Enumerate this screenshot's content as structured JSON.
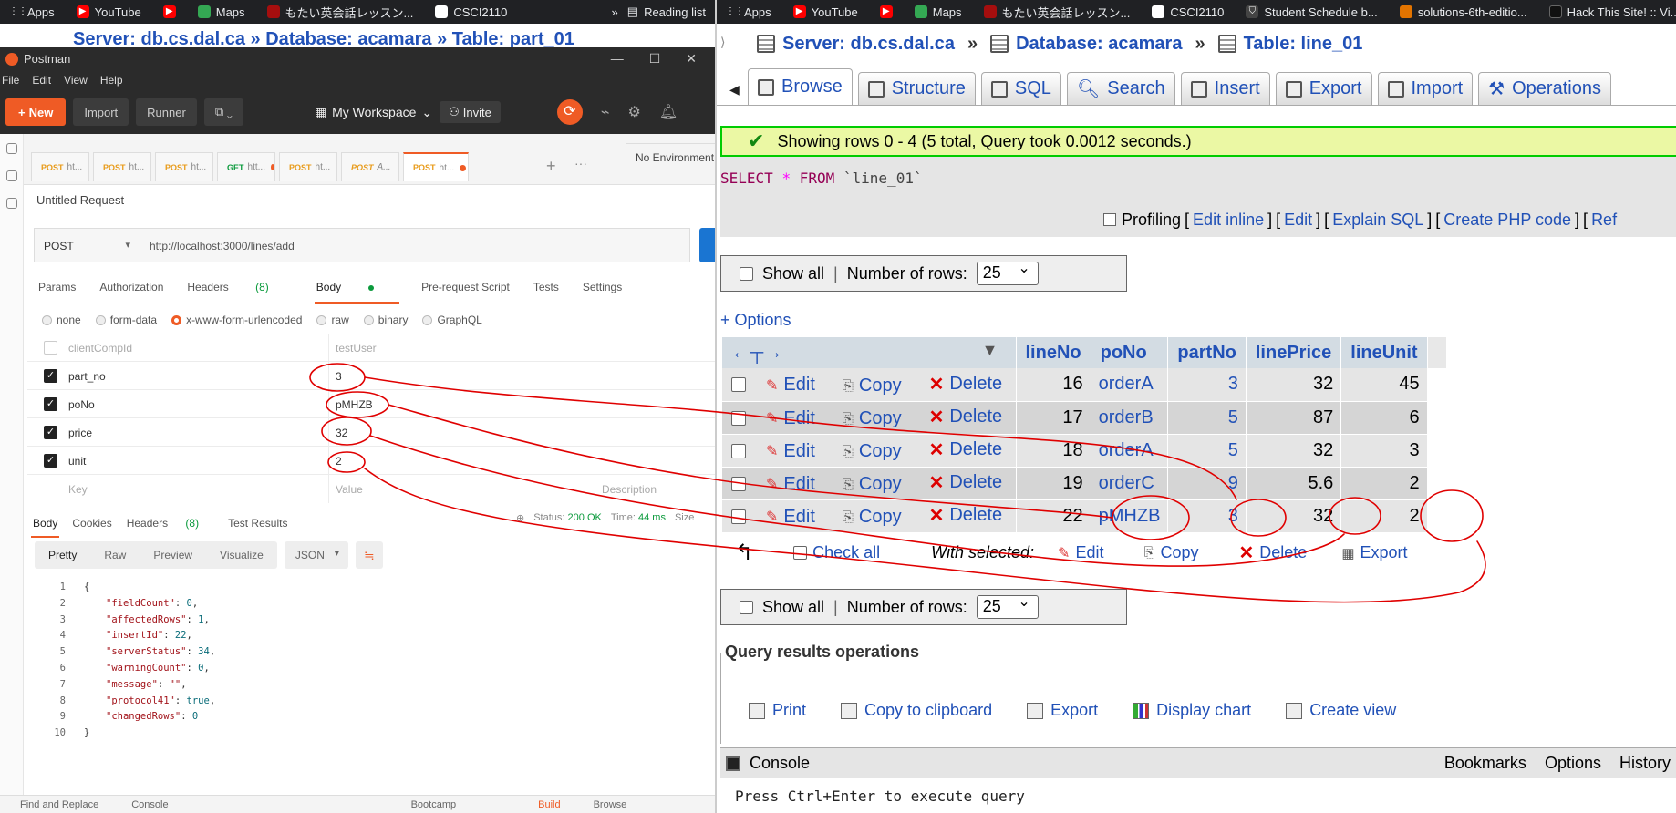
{
  "bookmarks_left": [
    "Apps",
    "YouTube",
    "",
    "Maps",
    "もたい英会話レッスン...",
    "CSCI2110"
  ],
  "bookmarks_left_extra": [
    "»",
    "Reading list"
  ],
  "bookmarks_right": [
    "Apps",
    "YouTube",
    "",
    "Maps",
    "もたい英会話レッスン...",
    "CSCI2110",
    "Student Schedule b...",
    "solutions-6th-editio...",
    "Hack This Site! :: Vi..."
  ],
  "bookmarks_right_more": "»",
  "hidden_bc": "Server: db.cs.dal.ca   »   Database: acamara   »   Table: part_01",
  "postman": {
    "title": "Postman",
    "menu": [
      "File",
      "Edit",
      "View",
      "Help"
    ],
    "new_label": "New",
    "import_label": "Import",
    "runner_label": "Runner",
    "workspace": "My Workspace",
    "invite": "Invite",
    "tabs": [
      {
        "method": "POST",
        "label": "ht..."
      },
      {
        "method": "POST",
        "label": "ht..."
      },
      {
        "method": "POST",
        "label": "ht..."
      },
      {
        "method": "GET",
        "label": "htt..."
      },
      {
        "method": "POST",
        "label": "ht..."
      },
      {
        "method": "POST",
        "label": "A..."
      },
      {
        "method": "POST",
        "label": "ht..."
      }
    ],
    "environment": "No Environment",
    "request_title": "Untitled Request",
    "method": "POST",
    "url": "http://localhost:3000/lines/add",
    "subtabs": {
      "params": "Params",
      "authorization": "Authorization",
      "headers": "Headers",
      "headers_count": "(8)",
      "body": "Body",
      "prerequest": "Pre-request Script",
      "tests": "Tests",
      "settings": "Settings"
    },
    "body_types": [
      "none",
      "form-data",
      "x-www-form-urlencoded",
      "raw",
      "binary",
      "GraphQL"
    ],
    "kv_header": {
      "key": "clientCompId",
      "value": "testUser"
    },
    "kv_rows": [
      {
        "key": "part_no",
        "value": "3"
      },
      {
        "key": "poNo",
        "value": "pMHZB"
      },
      {
        "key": "price",
        "value": "32"
      },
      {
        "key": "unit",
        "value": "2"
      }
    ],
    "kv_placeholder": {
      "key": "Key",
      "value": "Value",
      "description": "Description"
    },
    "resp_tabs": {
      "body": "Body",
      "cookies": "Cookies",
      "headers": "Headers",
      "headers_count": "(8)",
      "test_results": "Test Results"
    },
    "status_label": "Status:",
    "status_value": "200 OK",
    "time_label": "Time:",
    "time_value": "44 ms",
    "size_label": "Size",
    "view_modes": [
      "Pretty",
      "Raw",
      "Preview",
      "Visualize"
    ],
    "format": "JSON",
    "code_lines": [
      {
        "n": "1",
        "text": "{"
      },
      {
        "n": "2",
        "key": "\"fieldCount\"",
        "val": "0",
        "end": ","
      },
      {
        "n": "3",
        "key": "\"affectedRows\"",
        "val": "1",
        "end": ","
      },
      {
        "n": "4",
        "key": "\"insertId\"",
        "val": "22",
        "end": ","
      },
      {
        "n": "5",
        "key": "\"serverStatus\"",
        "val": "34",
        "end": ","
      },
      {
        "n": "6",
        "key": "\"warningCount\"",
        "val": "0",
        "end": ","
      },
      {
        "n": "7",
        "key": "\"message\"",
        "val": "\"\"",
        "end": ","
      },
      {
        "n": "8",
        "key": "\"protocol41\"",
        "val": "true",
        "end": ","
      },
      {
        "n": "9",
        "key": "\"changedRows\"",
        "val": "0",
        "end": ""
      },
      {
        "n": "10",
        "text": "}"
      }
    ],
    "footer": {
      "find": "Find and Replace",
      "console": "Console",
      "bootcamp": "Bootcamp",
      "build": "Build",
      "browse": "Browse"
    }
  },
  "pma": {
    "breadcrumb": {
      "server": "Server: db.cs.dal.ca",
      "database": "Database: acamara",
      "table": "Table: line_01",
      "sep": "»"
    },
    "tabs": [
      "Browse",
      "Structure",
      "SQL",
      "Search",
      "Insert",
      "Export",
      "Import",
      "Operations"
    ],
    "message": "Showing rows 0 - 4 (5 total, Query took 0.0012 seconds.)",
    "sql": {
      "kw1": "SELECT",
      "star": "*",
      "kw2": "FROM",
      "table": "`line_01`"
    },
    "profiling": {
      "label": "Profiling",
      "edit_inline": "Edit inline",
      "edit": "Edit",
      "explain": "Explain SQL",
      "php": "Create PHP code",
      "ref": "Ref"
    },
    "show_all": "Show all",
    "num_rows_label": "Number of rows:",
    "num_rows": "25",
    "options": "+ Options",
    "columns": [
      "lineNo",
      "poNo",
      "partNo",
      "linePrice",
      "lineUnit"
    ],
    "actions": {
      "edit": "Edit",
      "copy": "Copy",
      "delete": "Delete"
    },
    "rows": [
      {
        "lineNo": "16",
        "poNo": "orderA",
        "partNo": "3",
        "linePrice": "32",
        "lineUnit": "45"
      },
      {
        "lineNo": "17",
        "poNo": "orderB",
        "partNo": "5",
        "linePrice": "87",
        "lineUnit": "6"
      },
      {
        "lineNo": "18",
        "poNo": "orderA",
        "partNo": "5",
        "linePrice": "32",
        "lineUnit": "3"
      },
      {
        "lineNo": "19",
        "poNo": "orderC",
        "partNo": "9",
        "linePrice": "5.6",
        "lineUnit": "2"
      },
      {
        "lineNo": "22",
        "poNo": "pMHZB",
        "partNo": "3",
        "linePrice": "32",
        "lineUnit": "2"
      }
    ],
    "check_all": "Check all",
    "with_selected": "With selected:",
    "ws_actions": {
      "edit": "Edit",
      "copy": "Copy",
      "delete": "Delete",
      "export": "Export"
    },
    "qro_title": "Query results operations",
    "qro_links": [
      "Print",
      "Copy to clipboard",
      "Export",
      "Display chart",
      "Create view"
    ],
    "console": {
      "label": "Console",
      "bookmarks": "Bookmarks",
      "options": "Options",
      "history": "History"
    },
    "prompt": "Press Ctrl+Enter to execute query"
  },
  "colors": {
    "postman_orange": "#ef5b25",
    "pma_link": "#2151b7",
    "success_border": "#00cc00",
    "annotation": "#e00000"
  }
}
